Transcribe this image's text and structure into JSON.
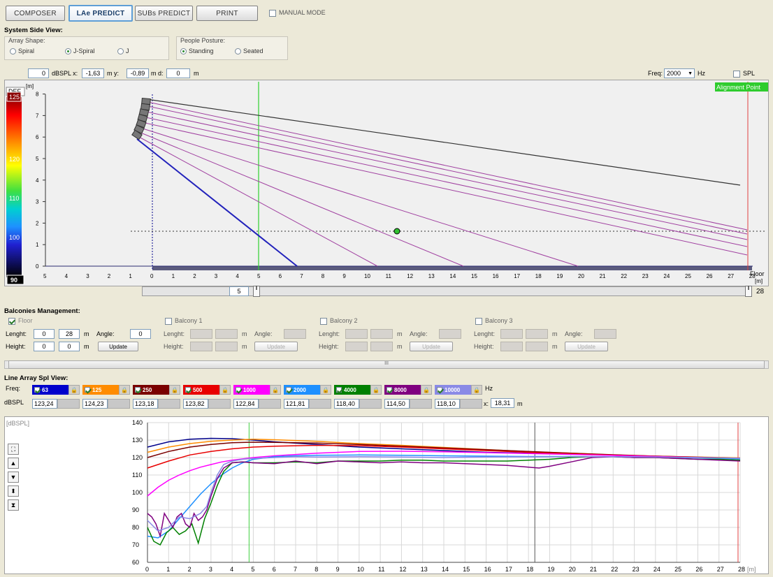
{
  "toolbar": {
    "composer": "COMPOSER",
    "lae_predict": "LAe PREDICT",
    "subs_predict": "SUBs PREDICT",
    "print": "PRINT",
    "manual_mode": "MANUAL MODE"
  },
  "side_view": {
    "title": "System Side View:",
    "array_shape_label": "Array Shape:",
    "shapes": [
      "Spiral",
      "J-Spiral",
      "J"
    ],
    "selected_shape": "J-Spiral",
    "people_posture_label": "People Posture:",
    "postures": [
      "Standing",
      "Seated"
    ],
    "selected_posture": "Standing"
  },
  "readout": {
    "dbspl_value": "0",
    "dbspl_unit": "dBSPL x:",
    "x_value": "-1,63",
    "x_unit": "m  y:",
    "y_value": "-0,89",
    "y_unit": "m  d:",
    "d_value": "0",
    "d_unit": "m",
    "freq_label": "Freq:",
    "freq_value": "2000",
    "freq_unit": "Hz",
    "spl_label": "SPL"
  },
  "side_chart": {
    "def_label": "DEF",
    "y_unit": "[m]",
    "color_scale": [
      "125",
      "120",
      "110",
      "100",
      "90"
    ],
    "alignment_label": "Alignment Point",
    "floor_label": "Floor",
    "x_unit": "[m]",
    "y_ticks": [
      "0",
      "1",
      "2",
      "3",
      "4",
      "5",
      "6",
      "7",
      "8"
    ],
    "x_ticks": [
      "5",
      "4",
      "3",
      "2",
      "1",
      "0",
      "1",
      "2",
      "3",
      "4",
      "5",
      "6",
      "7",
      "8",
      "9",
      "10",
      "11",
      "12",
      "13",
      "14",
      "15",
      "16",
      "17",
      "18",
      "19",
      "20",
      "21",
      "22",
      "23",
      "24",
      "25",
      "26",
      "27",
      "28"
    ],
    "slider_left_value": "5",
    "slider_right_value": "28"
  },
  "balconies": {
    "title": "Balconies Management:",
    "floor": {
      "label": "Floor",
      "length_label": "Lenght:",
      "length_from": "0",
      "length_to": "28",
      "unit": "m",
      "angle_label": "Angle:",
      "angle": "0",
      "height_label": "Height:",
      "height_from": "0",
      "height_to": "0",
      "update": "Update"
    },
    "items": [
      {
        "label": "Balcony 1",
        "length_label": "Lenght:",
        "unit": "m",
        "angle_label": "Angle:",
        "height_label": "Height:",
        "update": "Update"
      },
      {
        "label": "Balcony 2",
        "length_label": "Lenght:",
        "unit": "m",
        "angle_label": "Angle:",
        "height_label": "Height:",
        "update": "Update"
      },
      {
        "label": "Balcony 3",
        "length_label": "Lenght:",
        "unit": "m",
        "angle_label": "Angle:",
        "height_label": "Height:",
        "update": "Update"
      }
    ],
    "scroll_mark": "III"
  },
  "spl_view": {
    "title": "Line Array Spl View:",
    "freq_label": "Freq:",
    "dbspl_label": "dBSPL",
    "hz_label": "Hz",
    "x_label": "x:",
    "x_value": "18,31",
    "x_unit": "m",
    "bands": [
      {
        "freq": "63",
        "value": "123,24",
        "color": "#0000cc"
      },
      {
        "freq": "125",
        "value": "124,23",
        "color": "#ff8c00"
      },
      {
        "freq": "250",
        "value": "123,18",
        "color": "#7a0000"
      },
      {
        "freq": "500",
        "value": "123,82",
        "color": "#e80000"
      },
      {
        "freq": "1000",
        "value": "122,84",
        "color": "#ff00ff"
      },
      {
        "freq": "2000",
        "value": "121,81",
        "color": "#1e90ff"
      },
      {
        "freq": "4000",
        "value": "118,40",
        "color": "#008000"
      },
      {
        "freq": "8000",
        "value": "114,50",
        "color": "#800080"
      },
      {
        "freq": "10000",
        "value": "118,10",
        "color": "#8a8ae6"
      }
    ]
  },
  "chart_data": {
    "type": "line",
    "ylabel": "[dBSPL]",
    "xlabel": "[m]",
    "ylim": [
      60,
      140
    ],
    "xlim": [
      0,
      28
    ],
    "y_ticks": [
      "140",
      "130",
      "120",
      "110",
      "100",
      "90",
      "80",
      "70",
      "60"
    ],
    "x_ticks": [
      "0",
      "1",
      "2",
      "3",
      "4",
      "5",
      "6",
      "7",
      "8",
      "9",
      "10",
      "11",
      "12",
      "13",
      "14",
      "15",
      "16",
      "17",
      "18",
      "19",
      "20",
      "21",
      "22",
      "23",
      "24",
      "25",
      "26",
      "27",
      "28"
    ],
    "grid": true,
    "cursor_green_x": 4.8,
    "cursor_dark_x": 18.3,
    "cursor_red_x": 27.9,
    "series": [
      {
        "name": "63",
        "color": "#00008b",
        "x": [
          0,
          1,
          2,
          3,
          4,
          5,
          6,
          8,
          10,
          12,
          14,
          16,
          18,
          20,
          22,
          24,
          26,
          28
        ],
        "y": [
          126,
          129,
          130.5,
          131,
          130.8,
          130,
          129,
          127.5,
          126,
          125,
          124,
          123,
          122.5,
          122,
          121.3,
          120.8,
          120.2,
          119.5
        ]
      },
      {
        "name": "125",
        "color": "#ff8c00",
        "x": [
          0,
          1,
          2,
          3,
          4,
          5,
          6,
          8,
          10,
          12,
          14,
          16,
          18,
          20,
          22,
          24,
          26,
          28
        ],
        "y": [
          123,
          126,
          128,
          129.3,
          130,
          130.5,
          130.2,
          129.3,
          128,
          127,
          125.8,
          124.6,
          123.4,
          122.5,
          121.5,
          120.8,
          120.3,
          119.8
        ]
      },
      {
        "name": "250",
        "color": "#7a0000",
        "x": [
          0,
          1,
          2,
          3,
          4,
          5,
          6,
          8,
          10,
          12,
          14,
          16,
          18,
          20,
          22,
          24,
          26,
          28
        ],
        "y": [
          120,
          123.5,
          126,
          127.5,
          128.5,
          128.8,
          128.7,
          128.3,
          127.5,
          126.5,
          125.5,
          124.5,
          123.5,
          122.5,
          121.6,
          120.8,
          120.2,
          119.6
        ]
      },
      {
        "name": "500",
        "color": "#e80000",
        "x": [
          0,
          1,
          2,
          3,
          4,
          5,
          6,
          8,
          10,
          12,
          14,
          16,
          18,
          20,
          22,
          24,
          26,
          28
        ],
        "y": [
          114,
          118,
          121.5,
          123.5,
          125,
          126,
          126.5,
          127,
          126.8,
          126,
          125,
          124,
          123,
          122.2,
          121.4,
          120.7,
          120.1,
          119.5
        ]
      },
      {
        "name": "1000",
        "color": "#ff00ff",
        "x": [
          0,
          0.5,
          1,
          1.5,
          2,
          2.5,
          3,
          3.5,
          4,
          5,
          6,
          8,
          10,
          12,
          14,
          16,
          18,
          20,
          22,
          24,
          26,
          28
        ],
        "y": [
          98,
          103,
          107,
          110,
          112.5,
          114.5,
          116,
          117.5,
          118.5,
          120,
          121,
          122.5,
          123.5,
          123.6,
          123.3,
          122.8,
          122.3,
          121.8,
          121.2,
          120.6,
          120,
          119.4
        ]
      },
      {
        "name": "2000",
        "color": "#1e90ff",
        "x": [
          0,
          0.5,
          1,
          1.5,
          2,
          2.5,
          3,
          3.5,
          4,
          4.5,
          5,
          6,
          7,
          8,
          10,
          12,
          14,
          16,
          18,
          20,
          22,
          24,
          26,
          28
        ],
        "y": [
          75,
          74,
          78,
          85,
          92,
          99,
          105,
          110,
          114,
          117,
          119,
          120.5,
          121,
          121.3,
          121.5,
          121.3,
          121,
          120.8,
          120.6,
          120.6,
          120.5,
          120.2,
          119.8,
          119.2
        ]
      },
      {
        "name": "4000",
        "color": "#008000",
        "x": [
          0,
          0.3,
          0.6,
          0.9,
          1.2,
          1.5,
          1.8,
          2.1,
          2.4,
          2.7,
          3,
          3.3,
          3.6,
          4,
          4.5,
          5,
          6,
          7,
          8,
          9,
          10,
          11,
          12,
          13,
          14,
          15,
          16,
          17,
          18,
          19,
          20,
          21,
          22,
          23,
          24,
          25,
          26,
          27,
          28
        ],
        "y": [
          80,
          72,
          70,
          77,
          80,
          76,
          78,
          82,
          71,
          85,
          94,
          104,
          112,
          117,
          117.5,
          117,
          117,
          117.5,
          117,
          118,
          118,
          118,
          118.5,
          118.5,
          118,
          118,
          118,
          118,
          118.5,
          119,
          120,
          120.5,
          120.5,
          120,
          120,
          119.5,
          119,
          119,
          118.5
        ]
      },
      {
        "name": "8000",
        "color": "#800080",
        "x": [
          0,
          0.2,
          0.4,
          0.6,
          0.8,
          1,
          1.2,
          1.4,
          1.6,
          1.8,
          2,
          2.2,
          2.4,
          2.6,
          2.8,
          3,
          3.3,
          3.6,
          4,
          4.5,
          5,
          6,
          7,
          8,
          9,
          10,
          11,
          12,
          13,
          14,
          15,
          16,
          17,
          18,
          18.5,
          19,
          20,
          21,
          22,
          23,
          24,
          25,
          26,
          27,
          28
        ],
        "y": [
          88,
          86,
          82,
          75,
          88,
          84,
          80,
          86,
          88,
          82,
          80,
          88,
          84,
          86,
          90,
          98,
          108,
          114,
          117,
          117.5,
          117,
          116.5,
          118,
          116.5,
          118,
          117.5,
          117,
          117.5,
          117,
          117,
          116.5,
          116,
          115.5,
          114.5,
          114,
          115,
          117.5,
          120,
          120.5,
          120,
          120,
          119.5,
          119,
          118.5,
          118
        ]
      },
      {
        "name": "10000",
        "color": "#8a8ae6",
        "x": [
          0,
          0.5,
          1,
          1.5,
          2,
          2.5,
          2.8,
          3,
          3.3,
          3.6,
          4,
          4.5,
          5,
          6,
          7,
          8,
          10,
          12,
          14,
          16,
          18,
          20,
          22,
          24,
          26,
          28
        ],
        "y": [
          84,
          78,
          80,
          86,
          85,
          88,
          92,
          100,
          110,
          116,
          118,
          119,
          119.5,
          120,
          120.5,
          120.3,
          120.5,
          120.3,
          120,
          120.3,
          120.4,
          120.5,
          120.5,
          120.3,
          120,
          119.6
        ]
      }
    ]
  }
}
